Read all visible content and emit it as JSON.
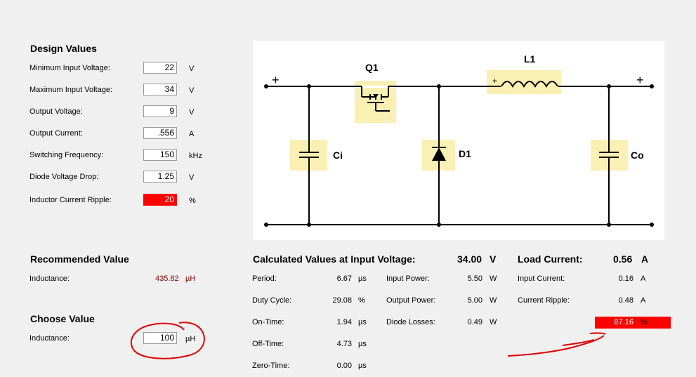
{
  "design": {
    "title": "Design Values",
    "fields": [
      {
        "label": "Minimum Input Voltage:",
        "value": "22",
        "unit": "V"
      },
      {
        "label": "Maximum Input Voltage:",
        "value": "34",
        "unit": "V"
      },
      {
        "label": "Output Voltage:",
        "value": "9",
        "unit": "V"
      },
      {
        "label": "Output Current:",
        "value": ".556",
        "unit": "A"
      },
      {
        "label": "Switching Frequency:",
        "value": "150",
        "unit": "kHz"
      },
      {
        "label": "Diode Voltage Drop:",
        "value": "1.25",
        "unit": "V"
      },
      {
        "label": "Inductor Current Ripple:",
        "value": "20",
        "unit": "%"
      }
    ]
  },
  "schematic": {
    "labels": {
      "q1": "Q1",
      "l1": "L1",
      "ci": "Ci",
      "d1": "D1",
      "co": "Co"
    },
    "plus": "+"
  },
  "recommended": {
    "title": "Recommended Value",
    "label": "Inductance:",
    "value": "435.82",
    "unit": "µH"
  },
  "choose": {
    "title": "Choose Value",
    "label": "Inductance:",
    "value": "100",
    "unit": "µH"
  },
  "calculated": {
    "title": "Calculated Values at Input Voltage:",
    "input_voltage": "34.00",
    "input_voltage_unit": "V",
    "rows": [
      {
        "label": "Period:",
        "value": "6.67",
        "unit": "µs"
      },
      {
        "label": "Duty Cycle:",
        "value": "29.08",
        "unit": "%"
      },
      {
        "label": "On-Time:",
        "value": "1.94",
        "unit": "µs"
      },
      {
        "label": "Off-Time:",
        "value": "4.73",
        "unit": "µs"
      },
      {
        "label": "Zero-Time:",
        "value": "0.00",
        "unit": "µs"
      }
    ],
    "power_rows": [
      {
        "label": "Input Power:",
        "value": "5.50",
        "unit": "W"
      },
      {
        "label": "Output Power:",
        "value": "5.00",
        "unit": "W"
      },
      {
        "label": "Diode Losses:",
        "value": "0.49",
        "unit": "W"
      }
    ]
  },
  "load": {
    "title": "Load Current:",
    "value": "0.56",
    "unit": "A",
    "rows": [
      {
        "label": "Input Current:",
        "value": "0.16",
        "unit": "A"
      },
      {
        "label": "Current Ripple:",
        "value": "0.48",
        "unit": "A"
      }
    ],
    "ripple_percent": "87.16",
    "ripple_percent_unit": "%"
  },
  "colors": {
    "alert": "#ff0000",
    "highlight": "#faf0b4",
    "annotation": "#e00000"
  }
}
